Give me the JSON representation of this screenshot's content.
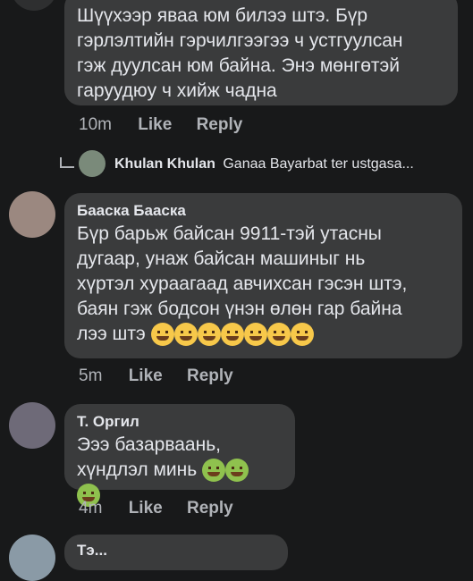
{
  "comments": [
    {
      "text_lines": [
        "Шүүхээр яваа юм билээ штэ. Бүр",
        "гэрлэлтийн гэрчилгээгээ ч устгуулсан",
        "гэж дуулсан юм байна. Энэ мөнгөтэй",
        "гаруудюу ч хийж чадна"
      ],
      "time": "10m",
      "like": "Like",
      "reply": "Reply"
    },
    {
      "author": "Бааска Бааска",
      "text_lines": [
        "Бүр барьж байсан 9911-тэй утасны",
        "дугаар, унаж байсан машиныг нь",
        "хүртэл хураагаад авчихсан гэсэн штэ,",
        "баян гэж бодсон үнэн өлөн гар байна",
        "лээ штэ"
      ],
      "emojis": [
        "laugh-crying-emoji",
        "hug-emoji",
        "tongue-emoji",
        "sweat-smile-emoji",
        "sweat-smile-emoji",
        "sweat-smile-emoji",
        "sweat-smile-emoji"
      ],
      "time": "5m",
      "like": "Like",
      "reply": "Reply"
    },
    {
      "author": "Т. Оргил",
      "text_lines": [
        "Эээ базарваань, хүндлэл минь"
      ],
      "emojis_inline": [
        "nauseated-emoji",
        "nauseated-emoji"
      ],
      "emojis_next": [
        "nauseated-emoji"
      ],
      "time": "4m",
      "like": "Like",
      "reply": "Reply"
    }
  ],
  "reply_preview": {
    "name": "Khulan Khulan",
    "snippet": "Ganaa Bayarbat ter ustgasa..."
  },
  "next_author_partial": "Тэ..."
}
